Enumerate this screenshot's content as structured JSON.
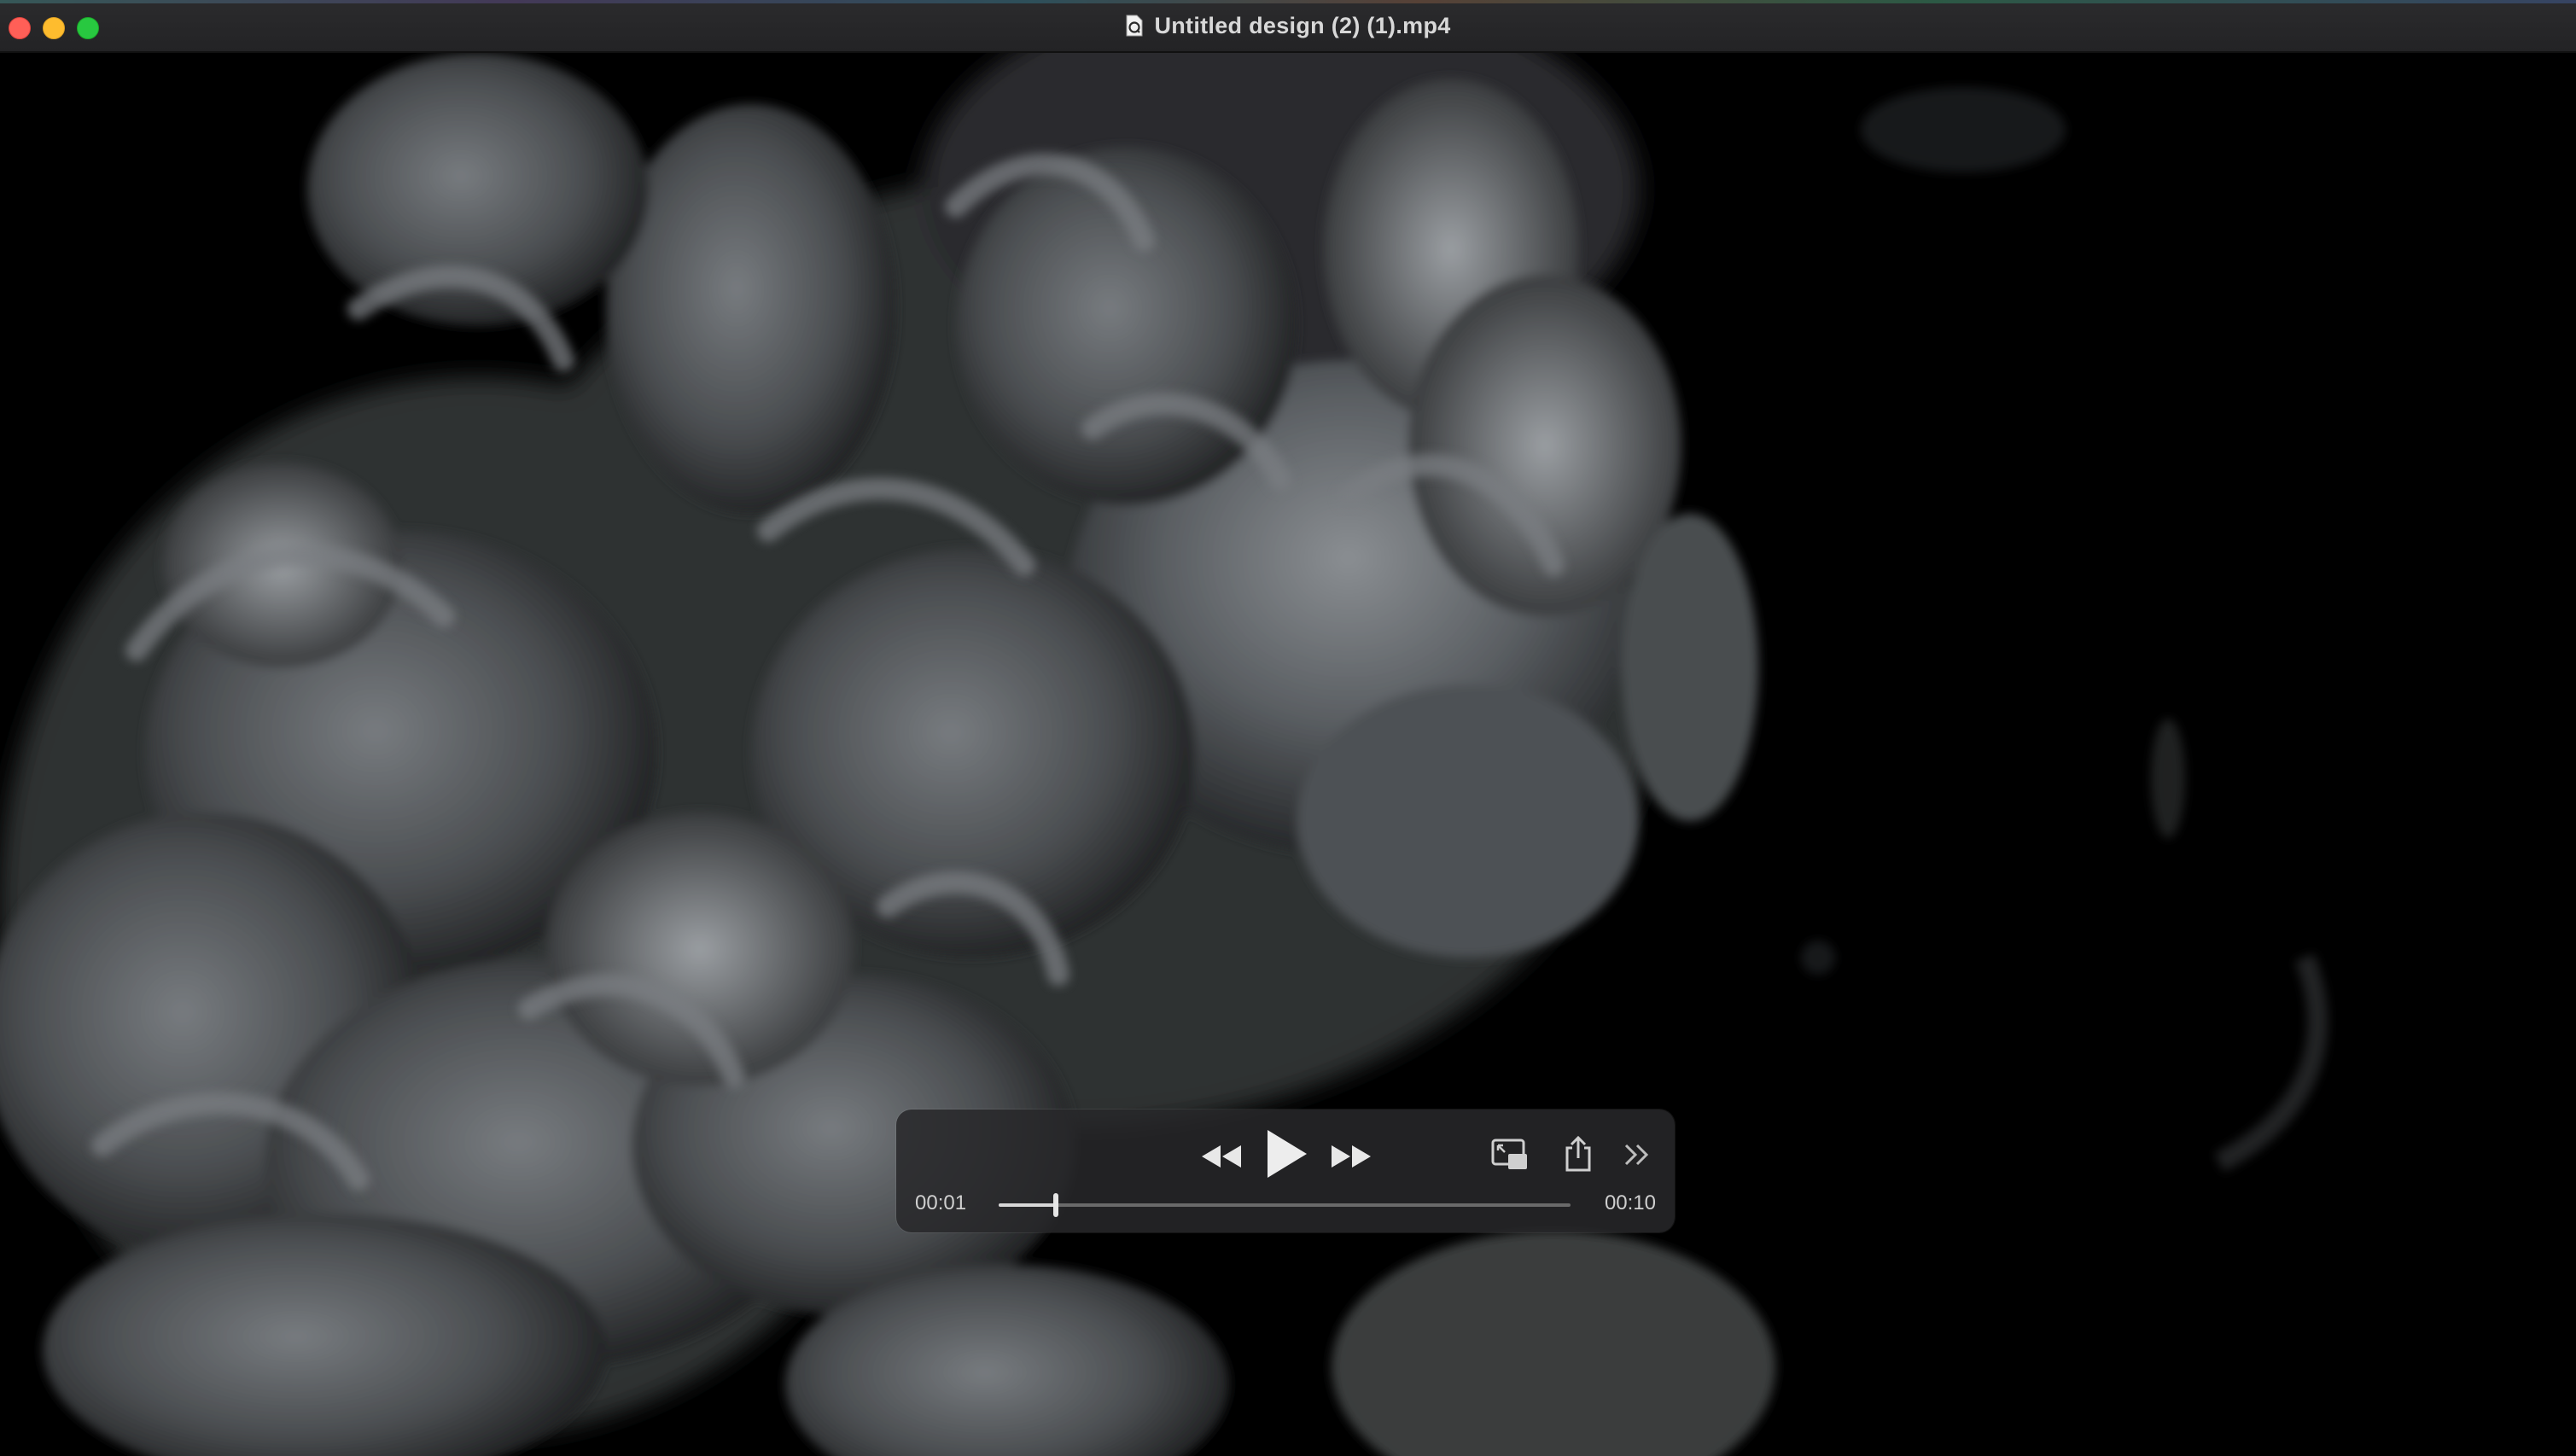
{
  "window": {
    "title": "Untitled design (2) (1).mp4",
    "doc_icon": "quicktime-document-icon",
    "traffic_lights": {
      "close": "#ff5f57",
      "minimize": "#febc2e",
      "zoom": "#28c840"
    }
  },
  "player": {
    "current_time": "00:01",
    "total_time": "00:10",
    "progress": 0.1,
    "state": "paused",
    "buttons": {
      "rewind": "rewind-icon",
      "play": "play-icon",
      "fast_forward": "fast-forward-icon",
      "picture_in_picture": "picture-in-picture-icon",
      "share": "share-icon",
      "more": "chevron-double-right-icon"
    }
  },
  "video": {
    "content": "grey ink smoke on black background"
  }
}
